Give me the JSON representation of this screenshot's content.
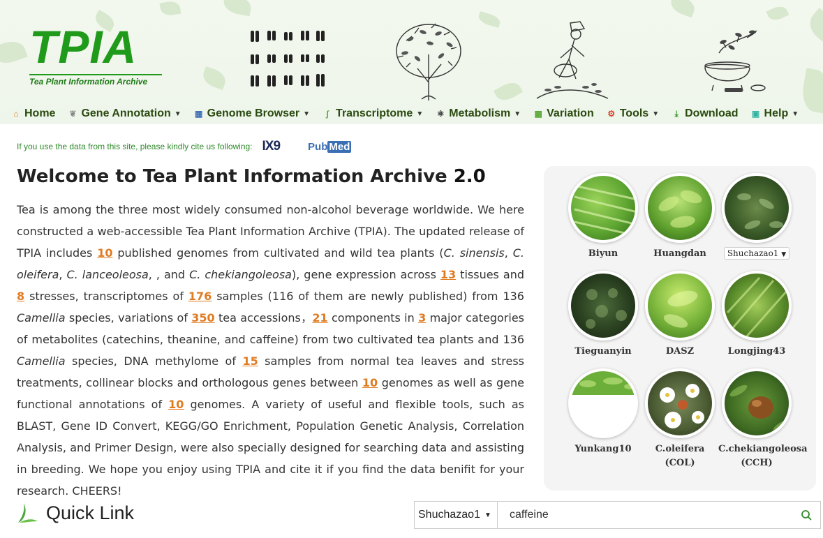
{
  "brand": {
    "title": "TPIA",
    "subtitle": "Tea Plant Information Archive",
    "color": "#1f9a1b"
  },
  "nav": [
    {
      "label": "Home",
      "icon": "home-icon",
      "dropdown": false
    },
    {
      "label": "Gene Annotation",
      "icon": "leaf-icon",
      "dropdown": true
    },
    {
      "label": "Genome Browser",
      "icon": "browser-icon",
      "dropdown": true
    },
    {
      "label": "Transcriptome",
      "icon": "dna-icon",
      "dropdown": true
    },
    {
      "label": "Metabolism",
      "icon": "molecule-icon",
      "dropdown": true
    },
    {
      "label": "Variation",
      "icon": "grid-icon",
      "dropdown": false
    },
    {
      "label": "Tools",
      "icon": "tools-icon",
      "dropdown": true
    },
    {
      "label": "Download",
      "icon": "download-icon",
      "dropdown": false
    },
    {
      "label": "Help",
      "icon": "help-icon",
      "dropdown": true
    }
  ],
  "cite": {
    "text": "If you use the data from this site, please kindly cite us following:",
    "ix9": "IX9",
    "pubmed_pub": "Pub",
    "pubmed_med": "Med"
  },
  "welcome": {
    "title": "Welcome to Tea Plant Information Archive",
    "version": "2.0"
  },
  "intro": {
    "p1": "Tea is among the three most widely consumed non-alcohol beverage worldwide. We here constructed a web-accessible Tea Plant Information Archive (TPIA). The updated release of TPIA includes ",
    "n_genomes": "10",
    "p2": " published genomes from cultivated and wild tea plants (",
    "sp1": "C. sinensis",
    "sep1": ", ",
    "sp2": "C. oleifera",
    "sep2": ", ",
    "sp3": "C. lanceoleosa",
    "sep3": ", , and ",
    "sp4": "C. chekiangoleosa",
    "p3": "), gene expression across ",
    "n_tissues": "13",
    "p4": " tissues and ",
    "n_stresses": "8",
    "p5": " stresses, transcriptomes of ",
    "n_samples": "176",
    "p6": " samples (116 of them are newly published) from 136 ",
    "sp5": "Camellia",
    "p7": " species, variations of ",
    "n_accessions": "350",
    "p8": " tea accessions，",
    "n_components": "21",
    "p9": " components in ",
    "n_categories": "3",
    "p10": " major categories of metabolites (catechins, theanine, and caffeine) from two cultivated tea plants and 136 ",
    "sp6": "Camellia",
    "p11": " species, DNA methylome of ",
    "n_methylome": "15",
    "p12": " samples from normal tea leaves and stress treatments, collinear blocks and orthologous genes between ",
    "n_collinear": "10",
    "p13": " genomes as well as gene functional annotations of ",
    "n_annotations": "10",
    "p14": " genomes. A variety of useful and flexible tools, such as BLAST, Gene ID Convert, KEGG/GO Enrichment, Population Genetic Analysis, Correlation Analysis, and Primer Design, were also specially designed for searching data and assisting in breeding. We hope you enjoy using TPIA and cite it if you find the data benifit for your research. CHEERS!"
  },
  "varieties": [
    {
      "label": "Biyun",
      "type": "text"
    },
    {
      "label": "Huangdan",
      "type": "text"
    },
    {
      "label": "Shuchazao1",
      "type": "select"
    },
    {
      "label": "Tieguanyin",
      "type": "text"
    },
    {
      "label": "DASZ",
      "type": "text"
    },
    {
      "label": "Longjing43",
      "type": "text"
    },
    {
      "label": "Yunkang10",
      "type": "text"
    },
    {
      "label": "C.oleifera",
      "label2": "(COL)",
      "type": "text"
    },
    {
      "label": "C.chekiangoleosa",
      "label2": "(CCH)",
      "type": "text"
    }
  ],
  "quick_link": {
    "label": "Quick Link"
  },
  "search": {
    "select_value": "Shuchazao1",
    "input_value": "caffeine",
    "accent": "#2f8a2a"
  }
}
